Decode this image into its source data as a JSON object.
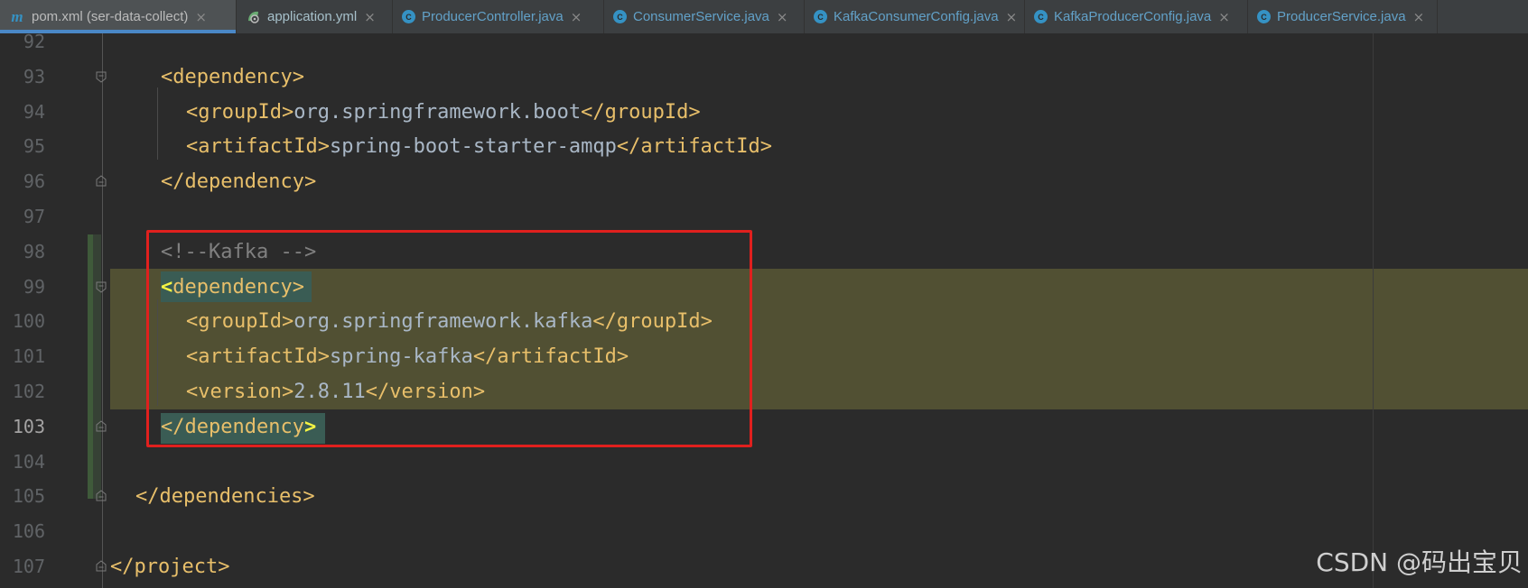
{
  "tabs": [
    {
      "label": "pom.xml (ser-data-collect)",
      "icon": "maven-icon",
      "active": true
    },
    {
      "label": "application.yml",
      "icon": "yaml-icon"
    },
    {
      "label": "ProducerController.java",
      "icon": "java-class-icon"
    },
    {
      "label": "ConsumerService.java",
      "icon": "java-class-icon"
    },
    {
      "label": "KafkaConsumerConfig.java",
      "icon": "java-class-icon"
    },
    {
      "label": "KafkaProducerConfig.java",
      "icon": "java-class-icon"
    },
    {
      "label": "ProducerService.java",
      "icon": "java-class-icon"
    }
  ],
  "tab_icon_letters": {
    "maven": "m",
    "java": "C"
  },
  "close_glyph": "×",
  "lines": [
    {
      "num": "92",
      "code": []
    },
    {
      "num": "93",
      "code": [
        {
          "t": "<dependency>",
          "c": "tag"
        }
      ]
    },
    {
      "num": "94",
      "code": [
        {
          "t": "<groupId>",
          "c": "tag"
        },
        {
          "t": "org.springframework.boot",
          "c": "txt"
        },
        {
          "t": "</groupId>",
          "c": "tag"
        }
      ]
    },
    {
      "num": "95",
      "code": [
        {
          "t": "<artifactId>",
          "c": "tag"
        },
        {
          "t": "spring-boot-starter-amqp",
          "c": "txt"
        },
        {
          "t": "</artifactId>",
          "c": "tag"
        }
      ]
    },
    {
      "num": "96",
      "code": [
        {
          "t": "</dependency>",
          "c": "tag"
        }
      ]
    },
    {
      "num": "97",
      "code": []
    },
    {
      "num": "98",
      "code": [
        {
          "t": "<!--Kafka -->",
          "c": "cmt"
        }
      ]
    },
    {
      "num": "99",
      "code": [
        {
          "t": "<",
          "c": "brk"
        },
        {
          "t": "dependency>",
          "c": "tag"
        }
      ]
    },
    {
      "num": "100",
      "code": [
        {
          "t": "<groupId>",
          "c": "tag"
        },
        {
          "t": "org.springframework.kafka",
          "c": "txt"
        },
        {
          "t": "</groupId>",
          "c": "tag"
        }
      ]
    },
    {
      "num": "101",
      "code": [
        {
          "t": "<artifactId>",
          "c": "tag"
        },
        {
          "t": "spring-kafka",
          "c": "txt"
        },
        {
          "t": "</artifactId>",
          "c": "tag"
        }
      ]
    },
    {
      "num": "102",
      "code": [
        {
          "t": "<version>",
          "c": "tag"
        },
        {
          "t": "2.8.11",
          "c": "txt"
        },
        {
          "t": "</version>",
          "c": "tag"
        }
      ]
    },
    {
      "num": "103",
      "code": [
        {
          "t": "</dependency",
          "c": "tag"
        },
        {
          "t": ">",
          "c": "brk"
        }
      ],
      "current": true
    },
    {
      "num": "104",
      "code": []
    },
    {
      "num": "105",
      "code": [
        {
          "t": "</dependencies>",
          "c": "tag"
        }
      ]
    },
    {
      "num": "106",
      "code": []
    },
    {
      "num": "107",
      "code": [
        {
          "t": "</project>",
          "c": "tag"
        }
      ]
    }
  ],
  "watermark": "CSDN @码出宝贝"
}
